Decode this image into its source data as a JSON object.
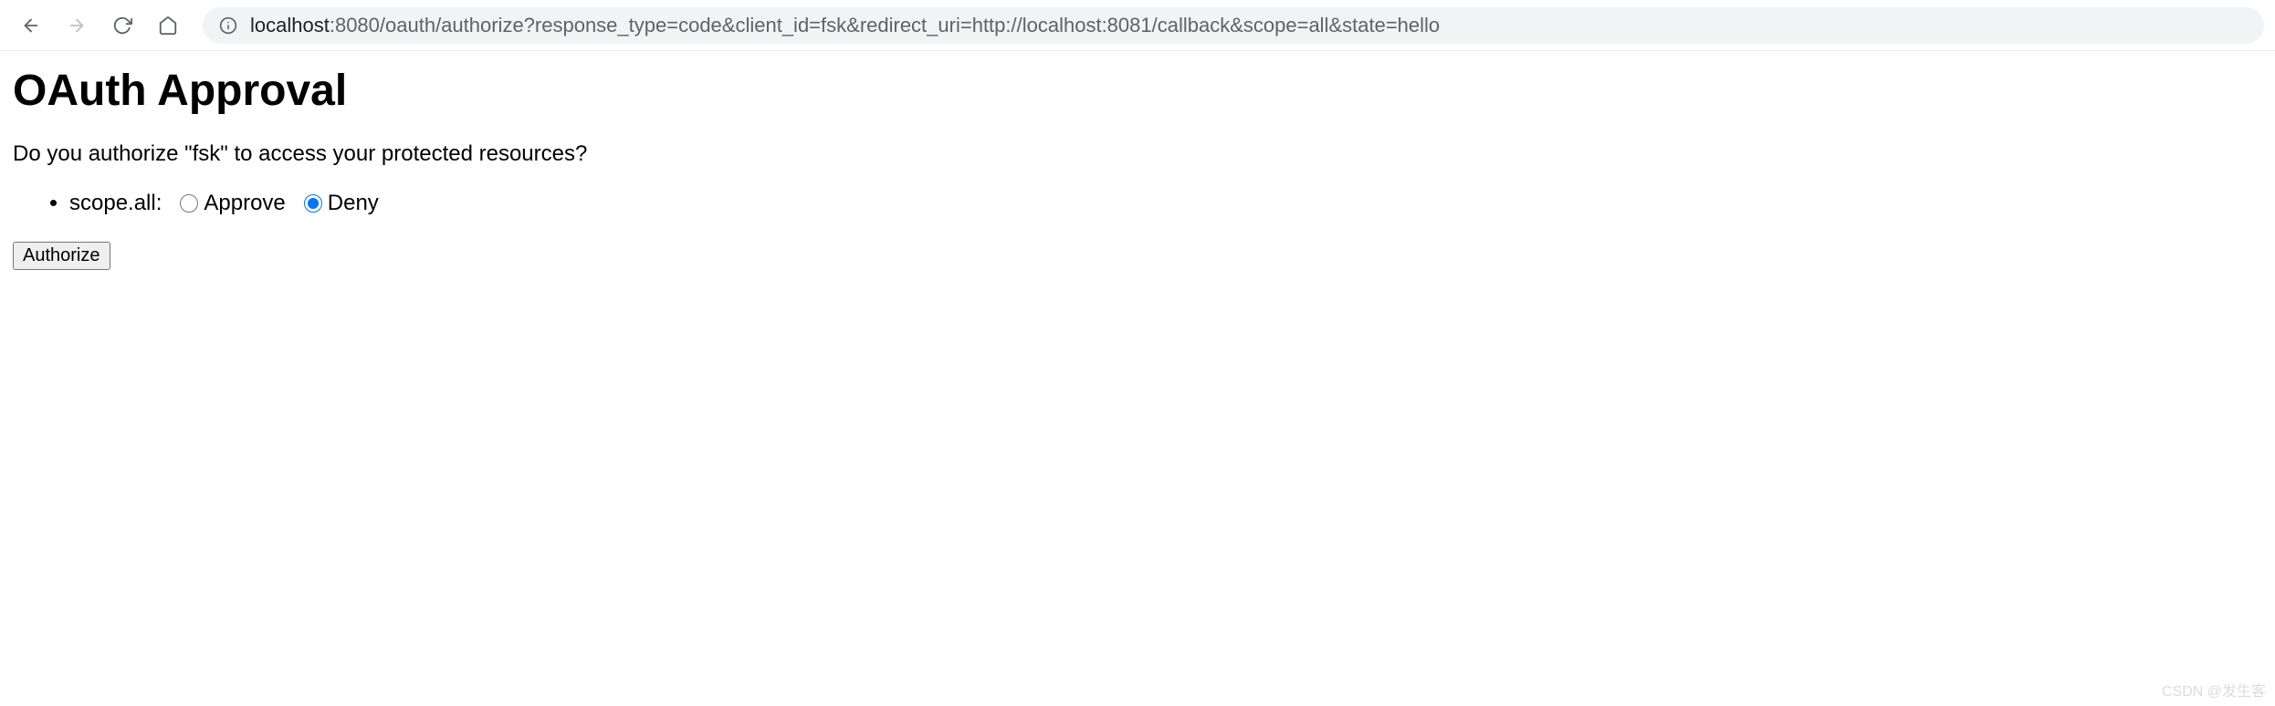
{
  "browser": {
    "url_host": "localhost",
    "url_rest": ":8080/oauth/authorize?response_type=code&client_id=fsk&redirect_uri=http://localhost:8081/callback&scope=all&state=hello"
  },
  "page": {
    "title": "OAuth Approval",
    "prompt": "Do you authorize \"fsk\" to access your protected resources?",
    "scope_label": "scope.all:",
    "approve_label": "Approve",
    "deny_label": "Deny",
    "selected": "deny",
    "submit_label": "Authorize"
  },
  "watermark": "CSDN @发生客"
}
